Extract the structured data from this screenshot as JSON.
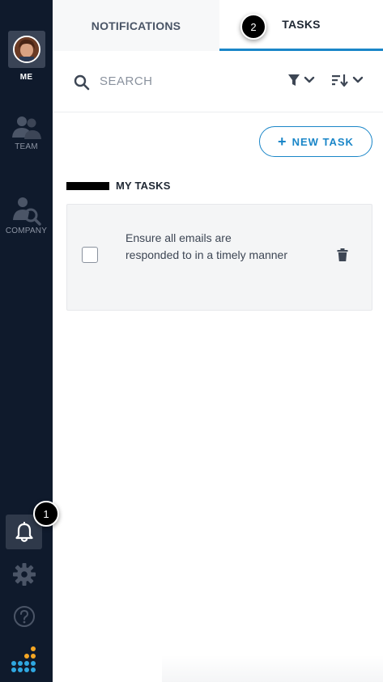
{
  "sidebar": {
    "items": [
      {
        "label": "ME",
        "icon": "avatar"
      },
      {
        "label": "TEAM",
        "icon": "team-icon"
      },
      {
        "label": "COMPANY",
        "icon": "company-search-icon"
      }
    ],
    "bottom_icons": [
      "bell-icon",
      "gear-icon",
      "help-icon",
      "logo-icon"
    ]
  },
  "annotations": {
    "badge_1": "1",
    "badge_2": "2"
  },
  "tabs": [
    {
      "label": "NOTIFICATIONS",
      "active": false
    },
    {
      "label": "TASKS",
      "active": true
    }
  ],
  "search": {
    "placeholder": "SEARCH",
    "value": ""
  },
  "toolbar": {
    "new_task_plus": "+",
    "new_task_label": "NEW TASK"
  },
  "section": {
    "title": "MY TASKS"
  },
  "tasks": [
    {
      "text": "Ensure all emails are responded to in a timely manner",
      "done": false
    }
  ],
  "colors": {
    "sidebar_bg": "#0f1a2c",
    "accent": "#1a86c8",
    "card_bg": "#f4f5f6"
  }
}
